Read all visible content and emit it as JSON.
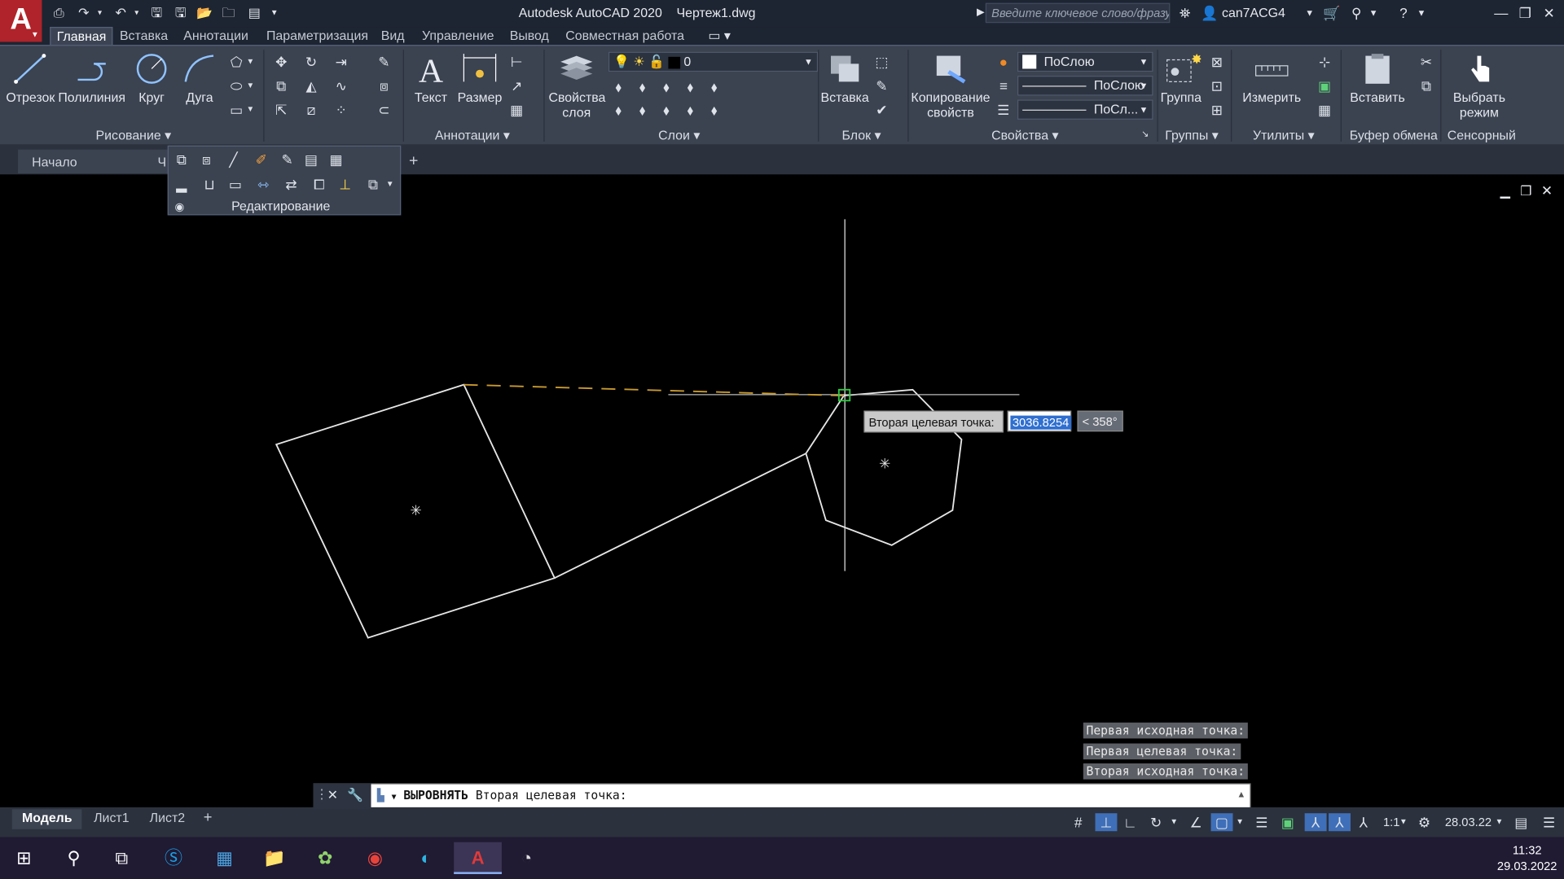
{
  "window": {
    "app_title": "Autodesk AutoCAD 2020",
    "doc_title": "Чертеж1.dwg",
    "search_placeholder": "Введите ключевое слово/фразу",
    "user": "can7ACG4"
  },
  "ribbon_tabs": [
    "Главная",
    "Вставка",
    "Аннотации",
    "Параметризация",
    "Вид",
    "Управление",
    "Вывод",
    "Совместная работа"
  ],
  "ribbon": {
    "draw": {
      "line": "Отрезок",
      "polyline": "Полилиния",
      "circle": "Круг",
      "arc": "Дуга",
      "title": "Рисование"
    },
    "annotation": {
      "text": "Текст",
      "dimension": "Размер",
      "title": "Аннотации"
    },
    "layers": {
      "layer_props_1": "Свойства",
      "layer_props_2": "слоя",
      "current_layer": "0",
      "title": "Слои"
    },
    "block": {
      "insert": "Вставка",
      "title": "Блок"
    },
    "properties": {
      "match_1": "Копирование",
      "match_2": "свойств",
      "color": "ПоСлою",
      "linetype": "ПоСлою",
      "lineweight": "ПоСл...",
      "title": "Свойства"
    },
    "groups": {
      "group": "Группа",
      "title": "Группы"
    },
    "utilities": {
      "measure": "Измерить",
      "title": "Утилиты"
    },
    "clipboard": {
      "paste": "Вставить",
      "title": "Буфер обмена"
    },
    "touch": {
      "select_1": "Выбрать",
      "select_2": "режим",
      "title": "Сенсорный"
    }
  },
  "file_tabs": {
    "start": "Начало",
    "partial": "Ч"
  },
  "flyout": {
    "title": "Редактирование"
  },
  "dynamic_input": {
    "prompt": "Вторая целевая точка:",
    "distance": "3036.8254",
    "angle": "< 358°"
  },
  "command_history": [
    "Первая исходная точка:",
    "Первая целевая точка:",
    "Вторая исходная точка:"
  ],
  "command_line": {
    "command": "ВЫРОВНЯТЬ",
    "prompt": "Вторая целевая точка:"
  },
  "layout_tabs": [
    "Модель",
    "Лист1",
    "Лист2"
  ],
  "status": {
    "scale": "1:1",
    "date_display": "28.03.22"
  },
  "taskbar": {
    "time": "11:32",
    "date": "29.03.2022"
  },
  "colors": {
    "accent_red": "#b0232a",
    "ribbon_bg": "#3b4250",
    "canvas": "#000000",
    "geometry": "#e6e6e6",
    "tracking": "#c99a2e",
    "osnap": "#2ecc40"
  }
}
